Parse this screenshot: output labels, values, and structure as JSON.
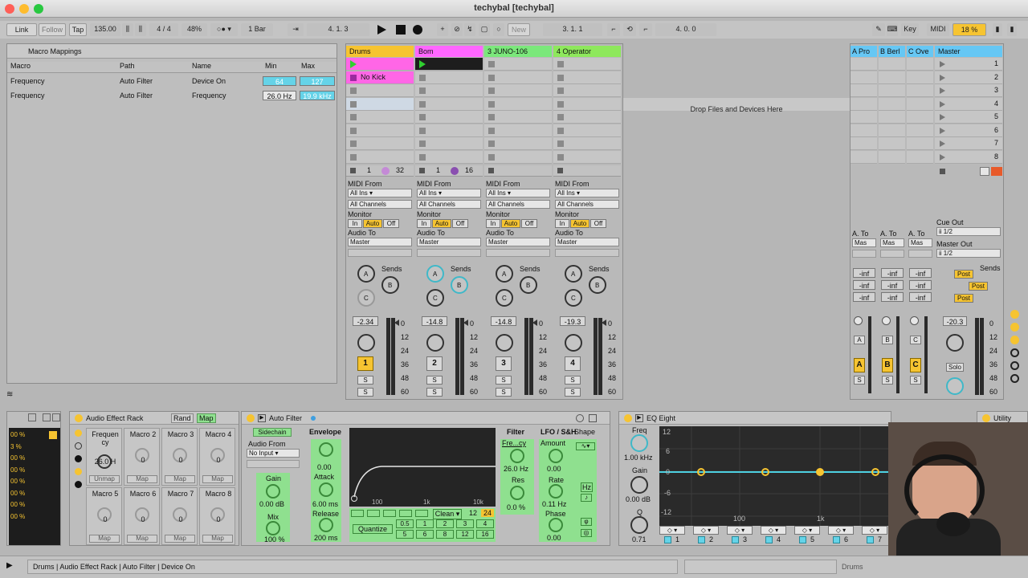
{
  "window": {
    "title": "techybal  [techybal]"
  },
  "transport": {
    "link": "Link",
    "follow": "Follow",
    "tap": "Tap",
    "tempo": "135.00",
    "signature": "4 / 4",
    "cpu": "48%",
    "quantize": "1 Bar",
    "position": "4.   1.   3",
    "loop_start": "3.   1.   1",
    "loop_length": "4.   0.   0",
    "new": "New",
    "key": "Key",
    "midi": "MIDI",
    "cpu_load": "18 %"
  },
  "macro_mappings": {
    "title": "Macro Mappings",
    "headers": [
      "Macro",
      "Path",
      "Name",
      "Min",
      "Max"
    ],
    "rows": [
      [
        "Frequency",
        "Auto Filter",
        "Device On",
        "64",
        "127"
      ],
      [
        "Frequency",
        "Auto Filter",
        "Frequency",
        "26.0 Hz",
        "19.9 kHz"
      ]
    ]
  },
  "tracks": [
    {
      "name": "Drums",
      "color": "#f6c431",
      "clip": "No Kick",
      "clip_color": "#ff66e6",
      "count_a": "1",
      "count_b": "32",
      "vol": "-2.34",
      "num": "1"
    },
    {
      "name": "Bom",
      "color": "#ff66ff",
      "count_a": "1",
      "count_b": "16",
      "vol": "-14.8",
      "num": "2"
    },
    {
      "name": "3 JUNO-106",
      "color": "#7be87b",
      "vol": "-14.8",
      "num": "3"
    },
    {
      "name": "4 Operator",
      "color": "#8ee85c",
      "vol": "-19.3",
      "num": "4"
    }
  ],
  "io": {
    "midi_from": "MIDI From",
    "all_ins": "All Ins",
    "all_channels": "All Channels",
    "monitor": "Monitor",
    "in": "In",
    "auto": "Auto",
    "off": "Off",
    "audio_to": "Audio To",
    "master": "Master",
    "sends": "Sends",
    "a": "A",
    "b": "B",
    "c": "C",
    "s": "S"
  },
  "returns": [
    {
      "name": "A Pro",
      "letter": "A"
    },
    {
      "name": "B Berl",
      "letter": "B"
    },
    {
      "name": "C Ove",
      "letter": "C"
    }
  ],
  "return_io": {
    "audio_to": "A. To",
    "dest": "Mas",
    "inf": "-inf"
  },
  "master": {
    "name": "Master",
    "cue_out": "Cue Out",
    "cue_val": "ii 1/2",
    "master_out": "Master Out",
    "master_val": "ii 1/2",
    "post": "Post",
    "sends": "Sends",
    "vol": "-20.3",
    "solo": "Solo",
    "scenes": [
      "1",
      "2",
      "3",
      "4",
      "5",
      "6",
      "7",
      "8"
    ]
  },
  "drop_hint": "Drop Files and Devices Here",
  "meter_ticks": [
    "0",
    "12",
    "24",
    "36",
    "48",
    "60"
  ],
  "left_strip": [
    "00 %",
    "3 %",
    "00 %",
    "00 %",
    "00 %",
    "00 %",
    "00 %",
    "00 %"
  ],
  "rack": {
    "title": "Audio Effect Rack",
    "rand": "Rand",
    "map": "Map",
    "macros": [
      {
        "name": "Frequen cy",
        "val": "26.0 H",
        "btn": "Unmap"
      },
      {
        "name": "Macro 2",
        "val": "0",
        "btn": "Map"
      },
      {
        "name": "Macro 3",
        "val": "0",
        "btn": "Map"
      },
      {
        "name": "Macro 4",
        "val": "0",
        "btn": "Map"
      },
      {
        "name": "Macro 5",
        "val": "0",
        "btn": "Map"
      },
      {
        "name": "Macro 6",
        "val": "0",
        "btn": "Map"
      },
      {
        "name": "Macro 7",
        "val": "0",
        "btn": "Map"
      },
      {
        "name": "Macro 8",
        "val": "0",
        "btn": "Map"
      }
    ]
  },
  "autofilter": {
    "title": "Auto Filter",
    "sidechain": "Sidechain",
    "audio_from": "Audio From",
    "no_input": "No Input",
    "gain": "Gain",
    "gain_val": "0.00 dB",
    "mix": "Mix",
    "mix_val": "100 %",
    "envelope": "Envelope",
    "env_val": "0.00",
    "attack": "Attack",
    "attack_val": "6.00 ms",
    "release": "Release",
    "release_val": "200 ms",
    "filter": "Filter",
    "freq": "Fre...cy",
    "freq_val": "26.0 Hz",
    "res": "Res",
    "res_val": "0.0 %",
    "lfo": "LFO / S&H",
    "amount": "Amount",
    "amount_val": "0.00",
    "shape": "Shape",
    "rate": "Rate",
    "rate_val": "0.11 Hz",
    "phase": "Phase",
    "phase_val": "0.00",
    "hz": "Hz",
    "graph_labels": [
      "100",
      "1k",
      "10k"
    ],
    "clean": "Clean",
    "n12": "12",
    "n24": "24",
    "quantize": "Quantize",
    "q_vals": [
      "0.5",
      "1",
      "2",
      "3",
      "4",
      "5",
      "6",
      "8",
      "12",
      "16"
    ]
  },
  "eq": {
    "title": "EQ Eight",
    "freq": "Freq",
    "freq_val": "1.00 kHz",
    "gain": "Gain",
    "gain_val": "0.00 dB",
    "q": "Q",
    "q_val": "0.71",
    "db_ticks": [
      "12",
      "6",
      "0",
      "-6",
      "-12"
    ],
    "freq_ticks": [
      "100",
      "1k"
    ],
    "bands": [
      "1",
      "2",
      "3",
      "4",
      "5",
      "6",
      "7"
    ]
  },
  "utility": {
    "title": "Utility"
  },
  "status": {
    "path": "Drums | Audio Effect Rack | Auto Filter | Device On",
    "track": "Drums"
  },
  "colors": {
    "cyan": "#65d3e8",
    "orange": "#f6c431",
    "pink": "#ff66ff",
    "green": "#8ee85c"
  }
}
